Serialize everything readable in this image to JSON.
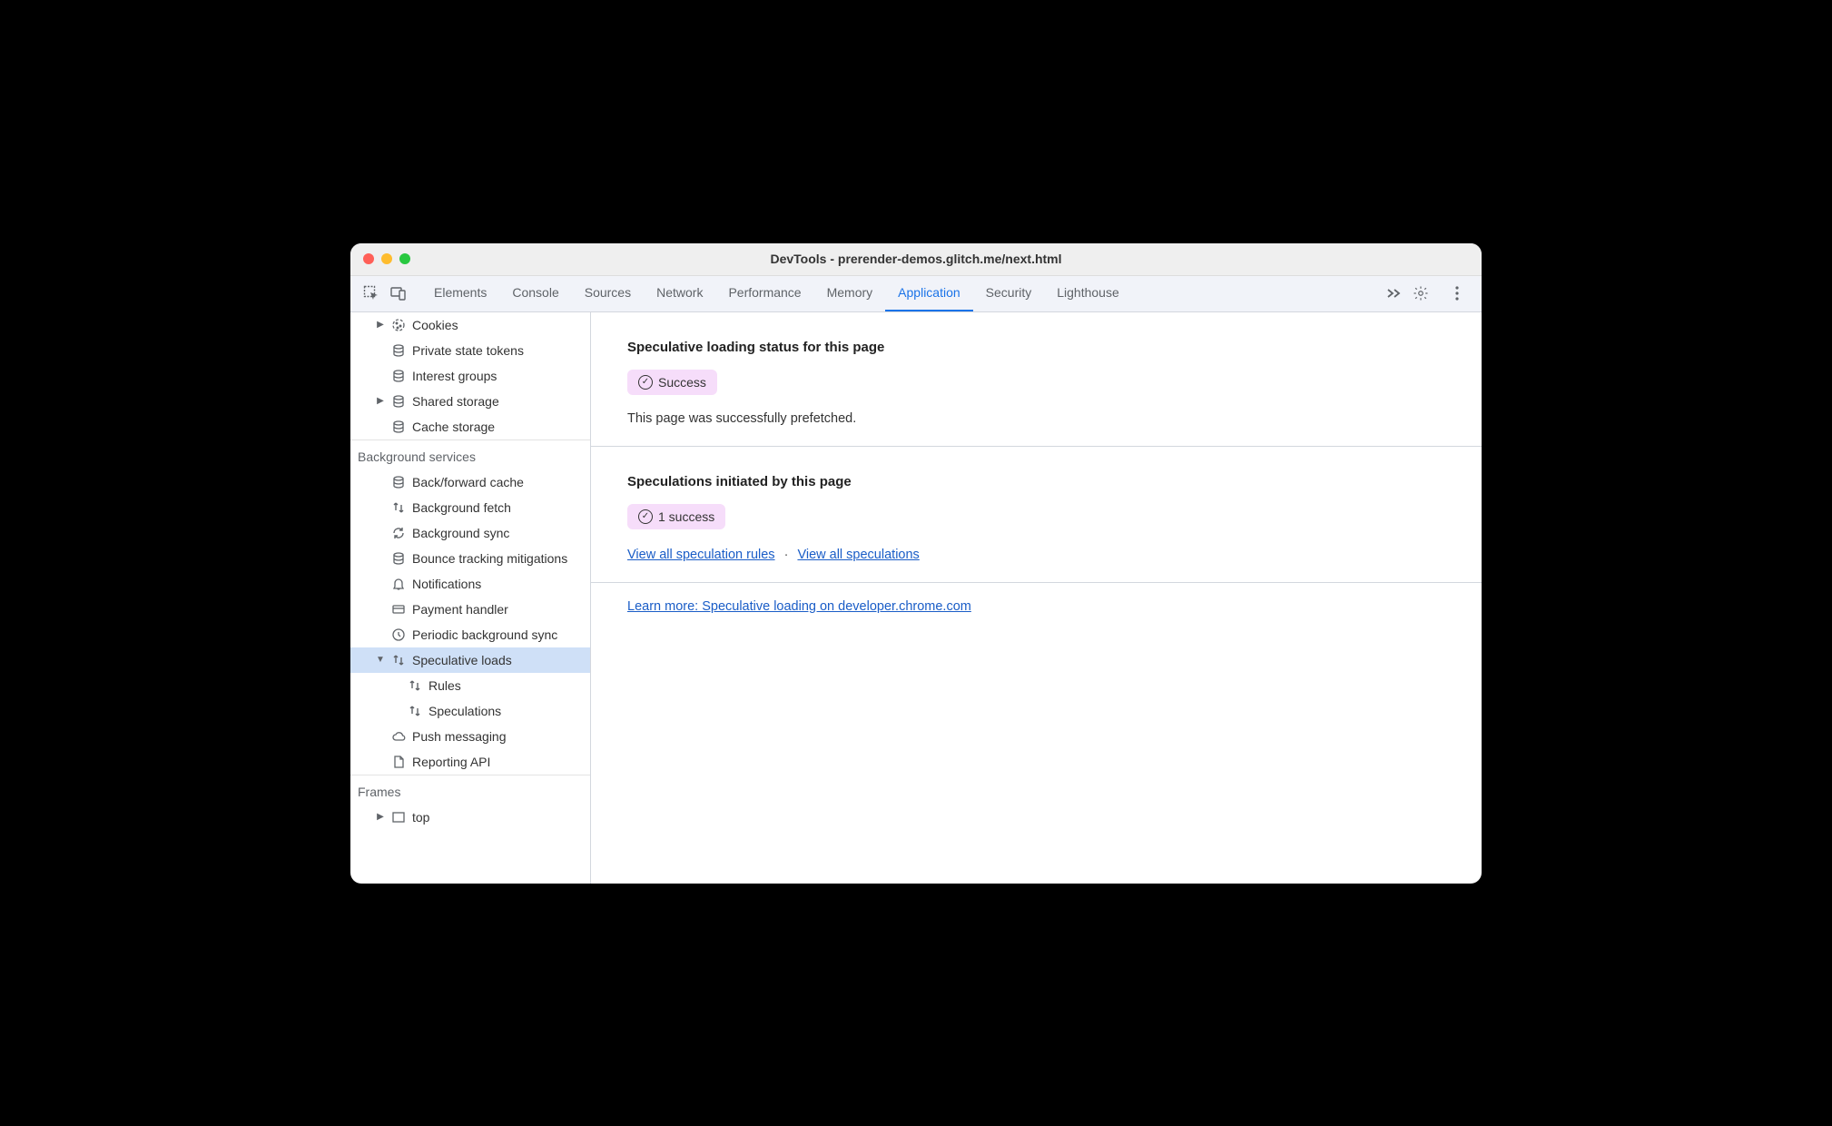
{
  "window": {
    "title": "DevTools - prerender-demos.glitch.me/next.html"
  },
  "tabs": {
    "items": [
      "Elements",
      "Console",
      "Sources",
      "Network",
      "Performance",
      "Memory",
      "Application",
      "Security",
      "Lighthouse"
    ],
    "active_index": 6
  },
  "sidebar": {
    "storage_items": [
      {
        "label": "Cookies",
        "icon": "cookie",
        "arrow": "right"
      },
      {
        "label": "Private state tokens",
        "icon": "database",
        "arrow": "blank"
      },
      {
        "label": "Interest groups",
        "icon": "database",
        "arrow": "blank"
      },
      {
        "label": "Shared storage",
        "icon": "database",
        "arrow": "right"
      },
      {
        "label": "Cache storage",
        "icon": "database",
        "arrow": "blank"
      }
    ],
    "bg_header": "Background services",
    "bg_items": [
      {
        "label": "Back/forward cache",
        "icon": "database",
        "arrow": "blank"
      },
      {
        "label": "Background fetch",
        "icon": "updown",
        "arrow": "blank"
      },
      {
        "label": "Background sync",
        "icon": "sync",
        "arrow": "blank"
      },
      {
        "label": "Bounce tracking mitigations",
        "icon": "database",
        "arrow": "blank"
      },
      {
        "label": "Notifications",
        "icon": "bell",
        "arrow": "blank"
      },
      {
        "label": "Payment handler",
        "icon": "card",
        "arrow": "blank"
      },
      {
        "label": "Periodic background sync",
        "icon": "clock",
        "arrow": "blank"
      },
      {
        "label": "Speculative loads",
        "icon": "updown",
        "arrow": "down",
        "selected": true
      },
      {
        "label": "Rules",
        "icon": "updown",
        "arrow": "blank",
        "indent": 2
      },
      {
        "label": "Speculations",
        "icon": "updown",
        "arrow": "blank",
        "indent": 2
      },
      {
        "label": "Push messaging",
        "icon": "cloud",
        "arrow": "blank"
      },
      {
        "label": "Reporting API",
        "icon": "doc",
        "arrow": "blank"
      }
    ],
    "frames_header": "Frames",
    "frames_item": {
      "label": "top",
      "icon": "frame",
      "arrow": "right"
    }
  },
  "main": {
    "status_heading": "Speculative loading status for this page",
    "status_badge": "Success",
    "status_desc": "This page was successfully prefetched.",
    "init_heading": "Speculations initiated by this page",
    "init_badge": "1 success",
    "link_rules": "View all speculation rules",
    "link_specs": "View all speculations",
    "learn_more": "Learn more: Speculative loading on developer.chrome.com"
  }
}
